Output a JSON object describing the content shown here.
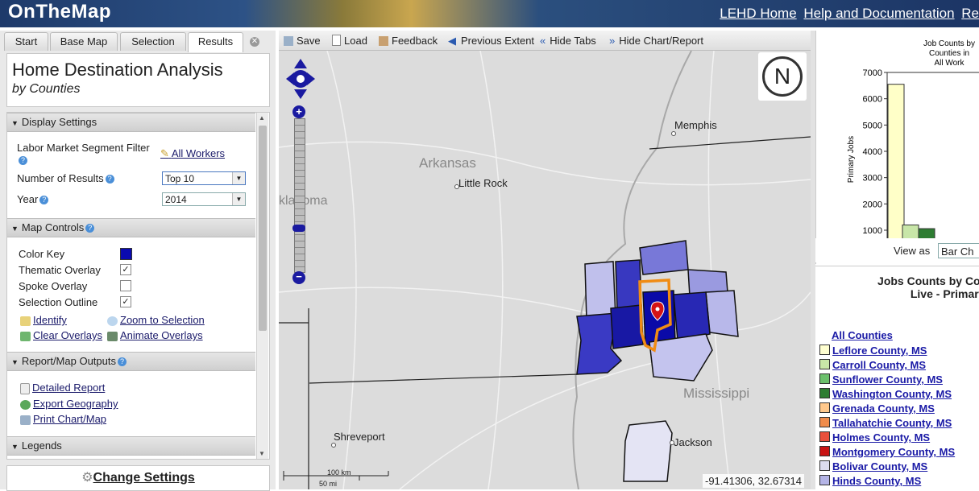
{
  "header": {
    "logo": "OnTheMap",
    "links": [
      "LEHD Home",
      "Help and Documentation",
      "Re"
    ]
  },
  "tabs": [
    "Start",
    "Base Map",
    "Selection",
    "Results"
  ],
  "active_tab": "Results",
  "analysis": {
    "title": "Home Destination Analysis",
    "subtitle": "by Counties"
  },
  "display_settings": {
    "header": "Display Settings",
    "segment_label": "Labor Market Segment Filter",
    "segment_value": "All Workers",
    "results_label": "Number of Results",
    "results_value": "Top 10",
    "year_label": "Year",
    "year_value": "2014"
  },
  "map_controls": {
    "header": "Map Controls",
    "color_key": "Color Key",
    "thematic": "Thematic Overlay",
    "spoke": "Spoke Overlay",
    "outline": "Selection Outline",
    "identify": "Identify",
    "zoom": "Zoom to Selection",
    "clear": "Clear Overlays",
    "animate": "Animate Overlays"
  },
  "report": {
    "header": "Report/Map Outputs",
    "detailed": "Detailed Report",
    "export": "Export Geography",
    "print": "Print Chart/Map"
  },
  "legends_header": "Legends",
  "change_settings": "Change Settings",
  "map_toolbar": [
    "Save",
    "Load",
    "Feedback",
    "Previous Extent",
    "Hide Tabs",
    "Hide Chart/Report"
  ],
  "map": {
    "labels": {
      "memphis": "Memphis",
      "arkansas": "Arkansas",
      "little_rock": "Little Rock",
      "oklahoma": "klahoma",
      "mississippi": "Mississippi",
      "shreveport": "Shreveport",
      "jackson": "Jackson"
    },
    "scale_km": "100 km",
    "scale_mi": "50 mi",
    "coords": "-91.41306, 32.67314",
    "compass": "N"
  },
  "chart_data": {
    "type": "bar",
    "title_lines": [
      "Job Counts by",
      "Counties in",
      "All Work"
    ],
    "ylabel": "Primary Jobs",
    "ylim": [
      1000,
      7000
    ],
    "yticks": [
      7000,
      6000,
      5000,
      4000,
      3000,
      2000,
      1000
    ],
    "categories": [
      "Leflore County, MS",
      "Carroll County, MS",
      "Sunflower County, MS"
    ],
    "values": [
      6550,
      1200,
      1060
    ],
    "colors": [
      "#ffffc8",
      "#c8e6a8",
      "#2e7d32"
    ]
  },
  "view_as": {
    "label": "View as",
    "value": "Bar Ch"
  },
  "list": {
    "title_line1": "Jobs Counts by Counties W",
    "title_line2": "Live - Primary J",
    "all": "All Counties",
    "items": [
      {
        "name": "Leflore County, MS",
        "color": "#ffffd0"
      },
      {
        "name": "Carroll County, MS",
        "color": "#c8e6a8"
      },
      {
        "name": "Sunflower County, MS",
        "color": "#6cc06c"
      },
      {
        "name": "Washington County, MS",
        "color": "#2e7d32"
      },
      {
        "name": "Grenada County, MS",
        "color": "#ffc88c"
      },
      {
        "name": "Tallahatchie County, MS",
        "color": "#f08c4c"
      },
      {
        "name": "Holmes County, MS",
        "color": "#e8503c"
      },
      {
        "name": "Montgomery County, MS",
        "color": "#c81414"
      },
      {
        "name": "Bolivar County, MS",
        "color": "#dcdcf0"
      },
      {
        "name": "Hinds County, MS",
        "color": "#b4b4e6"
      }
    ]
  }
}
